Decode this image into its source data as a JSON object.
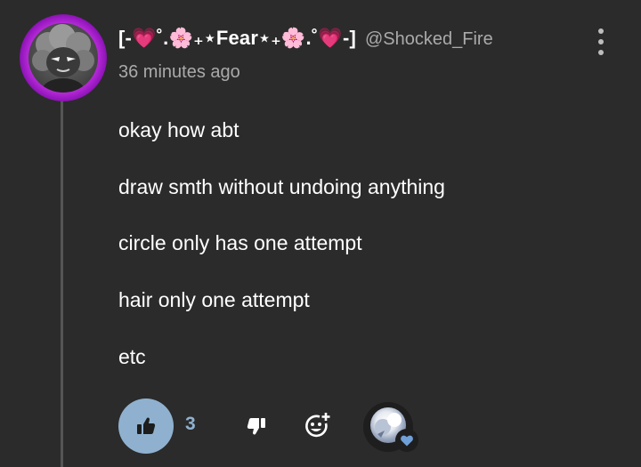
{
  "comment": {
    "author": {
      "display_name": "[-💗˚.🌸₊⋆Fear⋆₊🌸.˚💗-]",
      "handle": "@Shocked_Fire"
    },
    "timestamp": "36 minutes ago",
    "body_lines": [
      "okay how abt",
      "draw smth without undoing anything",
      "circle only has one attempt",
      "hair only one attempt",
      "etc"
    ],
    "actions": {
      "like_count": "3",
      "like_icon": "thumbs-up-icon",
      "dislike_icon": "thumbs-down-icon",
      "react_icon": "add-reaction-icon",
      "menu_icon": "kebab-menu-icon",
      "creator_heart_icon": "heart-icon"
    }
  },
  "colors": {
    "background": "#2b2b2b",
    "accent": "#8fb1cf",
    "secondary_text": "#aaaaaa",
    "avatar_glow": "#d63cf0",
    "heart": "#6fa0d8"
  }
}
